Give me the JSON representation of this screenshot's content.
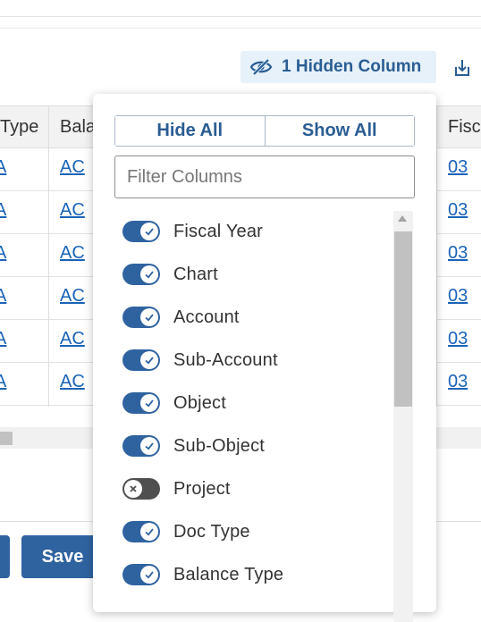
{
  "toolbar": {
    "hidden_columns_label": "1 Hidden Column",
    "hidden_icon": "eye-slash-icon",
    "export_icon": "download-icon"
  },
  "table": {
    "headers": [
      "Type",
      "Bala",
      "Fisc"
    ],
    "rows": [
      {
        "type": "A",
        "balance": "AC",
        "fiscal": "03"
      },
      {
        "type": "A",
        "balance": "AC",
        "fiscal": "03"
      },
      {
        "type": "A",
        "balance": "AC",
        "fiscal": "03"
      },
      {
        "type": "A",
        "balance": "AC",
        "fiscal": "03"
      },
      {
        "type": "A",
        "balance": "AC",
        "fiscal": "03"
      },
      {
        "type": "A",
        "balance": "AC",
        "fiscal": "03"
      }
    ]
  },
  "popover": {
    "hide_all": "Hide All",
    "show_all": "Show All",
    "filter_placeholder": "Filter Columns",
    "columns": [
      {
        "label": "Fiscal Year",
        "visible": true
      },
      {
        "label": "Chart",
        "visible": true
      },
      {
        "label": "Account",
        "visible": true
      },
      {
        "label": "Sub-Account",
        "visible": true
      },
      {
        "label": "Object",
        "visible": true
      },
      {
        "label": "Sub-Object",
        "visible": true
      },
      {
        "label": "Project",
        "visible": false
      },
      {
        "label": "Doc Type",
        "visible": true
      },
      {
        "label": "Balance Type",
        "visible": true
      }
    ]
  },
  "footer": {
    "save_label": "Save"
  },
  "colors": {
    "accent": "#2f63a0",
    "link": "#1a63b7",
    "chip_bg": "#e7f1f9",
    "toggle_off": "#4f4f4f"
  }
}
